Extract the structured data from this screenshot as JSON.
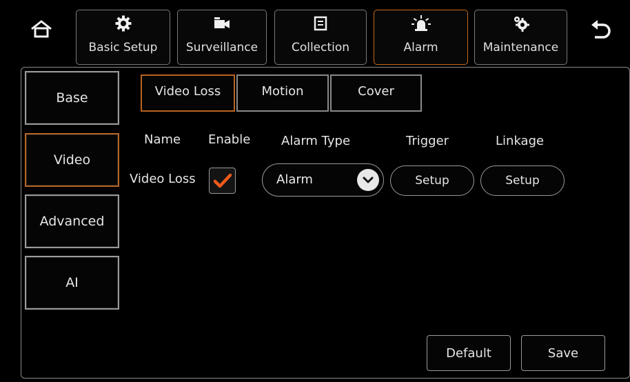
{
  "top_nav": {
    "tabs": [
      {
        "label": "Basic Setup",
        "icon": "gear-icon"
      },
      {
        "label": "Surveillance",
        "icon": "video-camera-icon"
      },
      {
        "label": "Collection",
        "icon": "document-icon"
      },
      {
        "label": "Alarm",
        "icon": "alarm-light-icon",
        "active": true
      },
      {
        "label": "Maintenance",
        "icon": "gears-icon"
      }
    ],
    "home_icon": "home-icon",
    "back_icon": "back-arrow-icon"
  },
  "sidebar": {
    "items": [
      {
        "label": "Base"
      },
      {
        "label": "Video",
        "active": true
      },
      {
        "label": "Advanced"
      },
      {
        "label": "AI"
      }
    ]
  },
  "sub_tabs": [
    {
      "label": "Video Loss",
      "active": true
    },
    {
      "label": "Motion"
    },
    {
      "label": "Cover"
    }
  ],
  "columns": {
    "name": "Name",
    "enable": "Enable",
    "alarm_type": "Alarm Type",
    "trigger": "Trigger",
    "linkage": "Linkage"
  },
  "row": {
    "name": "Video Loss",
    "enabled": true,
    "alarm_type": "Alarm",
    "trigger_label": "Setup",
    "linkage_label": "Setup"
  },
  "footer": {
    "default_label": "Default",
    "save_label": "Save"
  },
  "colors": {
    "background": "#000000",
    "accent": "#c86a1c",
    "check": "#f05a1a"
  }
}
